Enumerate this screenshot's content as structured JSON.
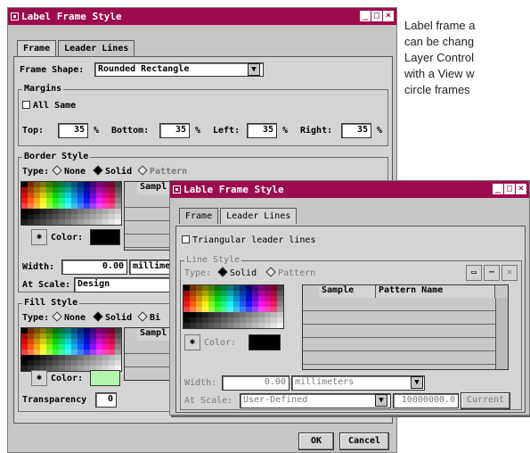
{
  "window1": {
    "title": "Label Frame Style",
    "tabs": [
      "Frame",
      "Leader Lines"
    ],
    "frame_shape_label": "Frame Shape:",
    "frame_shape_value": "Rounded Rectangle",
    "margins": {
      "legend": "Margins",
      "all_same": "All Same",
      "top_label": "Top:",
      "top_value": "35",
      "bottom_label": "Bottom:",
      "bottom_value": "35",
      "left_label": "Left:",
      "left_value": "35",
      "right_label": "Right:",
      "right_value": "35",
      "unit": "%"
    },
    "border_style": {
      "legend": "Border Style",
      "type_label": "Type:",
      "opt_none": "None",
      "opt_solid": "Solid",
      "opt_pattern": "Pattern",
      "sample_header": "Sampl",
      "color_label": "Color:",
      "color_value": "#000000",
      "width_label": "Width:",
      "width_value": "0.00",
      "width_unit": "millime",
      "scale_label": "At Scale:",
      "scale_value": "Design"
    },
    "fill_style": {
      "legend": "Fill Style",
      "type_label": "Type:",
      "opt_none": "None",
      "opt_solid": "Solid",
      "opt_bitmap": "Bi",
      "sample_header": "Sampl",
      "color_label": "Color:",
      "color_value": "#b6f5b0",
      "transparency_label": "Transparency",
      "transparency_value": "0"
    },
    "ok_label": "OK",
    "cancel_label": "Cancel"
  },
  "window2": {
    "title": "Lable Frame Style",
    "tabs": [
      "Frame",
      "Leader Lines"
    ],
    "triangular_label": "Triangular leader lines",
    "line_style": {
      "legend": "Line Style",
      "type_label": "Type:",
      "opt_solid": "Solid",
      "opt_pattern": "Pattern",
      "col_sample": "Sample",
      "col_pattern_name": "Pattern Name",
      "color_label": "Color:",
      "color_value": "#000000",
      "width_label": "Width:",
      "width_value": "0.00",
      "width_unit": "millimeters",
      "scale_label": "At Scale:",
      "scale_value": "User-Defined",
      "scale_number": "10000000.0",
      "current_label": "Current"
    }
  },
  "description_lines": [
    "Label frame a",
    "can be chang",
    "Layer Control",
    "with a View w",
    "circle frames"
  ],
  "title_bar_color": "#9c0c4c"
}
